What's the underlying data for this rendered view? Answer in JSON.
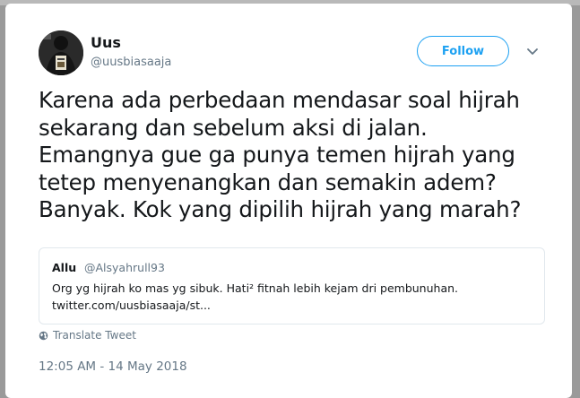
{
  "user": {
    "name": "Uus",
    "handle": "@uusbiasaaja"
  },
  "follow_label": "Follow",
  "tweet_text": "Karena ada perbedaan mendasar soal hijrah\nsekarang dan sebelum aksi di jalan.\nEmangnya gue ga punya temen hijrah yang\ntetep menyenangkan dan semakin adem?\nBanyak. Kok yang dipilih hijrah yang marah?",
  "quoted": {
    "name": "Allu",
    "handle": "@Alsyahrull93",
    "text": "Org yg hijrah ko mas yg sibuk. Hati² fitnah lebih kejam dri pembunuhan.",
    "link": "twitter.com/uusbiasaaja/st..."
  },
  "translate_label": "Translate Tweet",
  "timestamp": "12:05 AM - 14 May 2018",
  "colors": {
    "accent": "#1da1f2",
    "text": "#14171a",
    "muted": "#657786",
    "border": "#e1e8ed"
  },
  "icons": [
    "avatar",
    "chevron-down-icon",
    "globe-icon"
  ]
}
